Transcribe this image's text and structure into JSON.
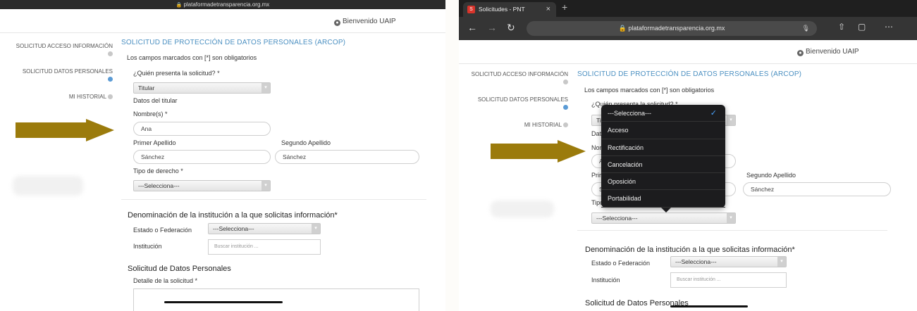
{
  "left": {
    "url": "plataformadetransparencia.org.mx",
    "welcome": "Bienvenido UAIP",
    "sidenav": [
      {
        "label": "SOLICITUD ACCESO INFORMACIÓN"
      },
      {
        "label": "SOLICITUD DATOS PERSONALES"
      },
      {
        "label": "MI HISTORIAL"
      }
    ],
    "form": {
      "title": "SOLICITUD DE PROTECCIÓN DE DATOS PERSONALES (ARCOP)",
      "required_note": "Los campos marcados con [*] son obligatorios",
      "who_label": "¿Quién presenta la solicitud? *",
      "who_value": "Titular",
      "holder_data": "Datos del titular",
      "name_label": "Nombre(s) *",
      "name_value": "Ana",
      "first_surname_label": "Primer Apellido",
      "first_surname_value": "Sánchez",
      "second_surname_label": "Segundo Apellido",
      "second_surname_value": "Sánchez",
      "right_type_label": "Tipo de derecho *",
      "right_type_value": "---Selecciona---",
      "institution_heading": "Denominación de la institución a la que solicitas información*",
      "state_label": "Estado o Federación",
      "state_value": "---Selecciona---",
      "institution_label": "Institución",
      "institution_placeholder": "Buscar institución ...",
      "personal_data_heading": "Solicitud de Datos Personales",
      "detail_label": "Detalle de la solicitud *"
    }
  },
  "right": {
    "tab_title": "Solicitudes - PNT",
    "url": "plataformadetransparencia.org.mx",
    "welcome": "Bienvenido UAIP",
    "sidenav": [
      {
        "label": "SOLICITUD ACCESO INFORMACIÓN"
      },
      {
        "label": "SOLICITUD DATOS PERSONALES"
      },
      {
        "label": "MI HISTORIAL"
      }
    ],
    "form": {
      "title": "SOLICITUD DE PROTECCIÓN DE DATOS PERSONALES (ARCOP)",
      "required_note": "Los campos marcados con [*] son obligatorios",
      "who_label": "¿Quién presenta la solicitud? *",
      "who_value_partial": "Tit",
      "holder_data_partial": "Dat",
      "name_label_partial": "Nor",
      "name_value_partial": "A",
      "first_surname_label_partial": "Prir",
      "first_surname_value_partial": "S",
      "second_surname_label": "Segundo Apellido",
      "second_surname_value": "Sánchez",
      "right_type_label_partial": "Tipo",
      "right_type_value": "---Selecciona---",
      "institution_heading": "Denominación de la institución a la que solicitas información*",
      "state_label": "Estado o Federación",
      "state_value": "---Selecciona---",
      "institution_label": "Institución",
      "institution_placeholder": "Buscar institución ...",
      "personal_data_heading": "Solicitud de Datos Personales"
    },
    "dropdown": {
      "options": [
        {
          "label": "---Selecciona---",
          "selected": true
        },
        {
          "label": "Acceso"
        },
        {
          "label": "Rectificación"
        },
        {
          "label": "Cancelación"
        },
        {
          "label": "Oposición"
        },
        {
          "label": "Portabilidad"
        }
      ]
    }
  },
  "colors": {
    "accent_title": "#4a8fc1",
    "arrow": "#9b7b0c",
    "dropdown_bg": "#1c1c1e"
  }
}
